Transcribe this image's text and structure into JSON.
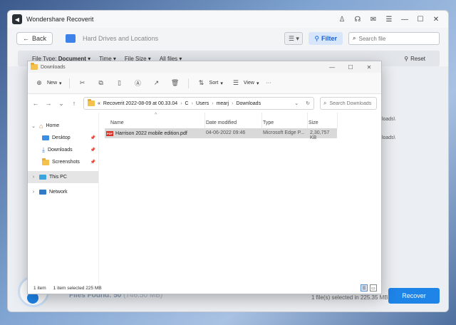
{
  "app": {
    "title": "Wondershare Recoverit",
    "logo_glyph": "◀",
    "back_label": "Back",
    "location": "Hard Drives and Locations",
    "filter_label": "Filter",
    "search_placeholder": "Search file",
    "filters": {
      "file_type_label": "File Type:",
      "file_type_value": "Document",
      "time": "Time",
      "file_size": "File Size",
      "all_files": "All files",
      "reset": "Reset"
    },
    "bg_paths": [
      "wnloads\\",
      "wnloads\\"
    ],
    "files_found_label": "Files Found:",
    "files_found_value": "50",
    "files_found_size": "(746.50 MB)",
    "selected_text": "1 file(s) selected in 225.35 MB",
    "recover_label": "Recover"
  },
  "explorer": {
    "title": "Downloads",
    "commands": {
      "new": "New",
      "sort": "Sort",
      "view": "View",
      "more": "···"
    },
    "address": {
      "prefix": "«",
      "crumbs": [
        "Recoverit 2022-08-09 at 00.33.04",
        "C",
        "Users",
        "mearj",
        "Downloads"
      ]
    },
    "search_placeholder": "Search Downloads",
    "nav": {
      "home": "Home",
      "desktop": "Desktop",
      "downloads": "Downloads",
      "screenshots": "Screenshots",
      "this_pc": "This PC",
      "network": "Network"
    },
    "columns": {
      "name": "Name",
      "date": "Date modified",
      "type": "Type",
      "size": "Size"
    },
    "files": [
      {
        "name": "Harrison 2022 mobile edition.pdf",
        "date": "04-06-2022 09:46",
        "type": "Microsoft Edge P...",
        "size": "2,30,757 KB"
      }
    ],
    "status": {
      "count": "1 item",
      "selected": "1 item selected  225 MB"
    }
  },
  "colors": {
    "accent": "#1e84e8",
    "filter_bg": "#d7e6fb",
    "pdf": "#d93025"
  }
}
